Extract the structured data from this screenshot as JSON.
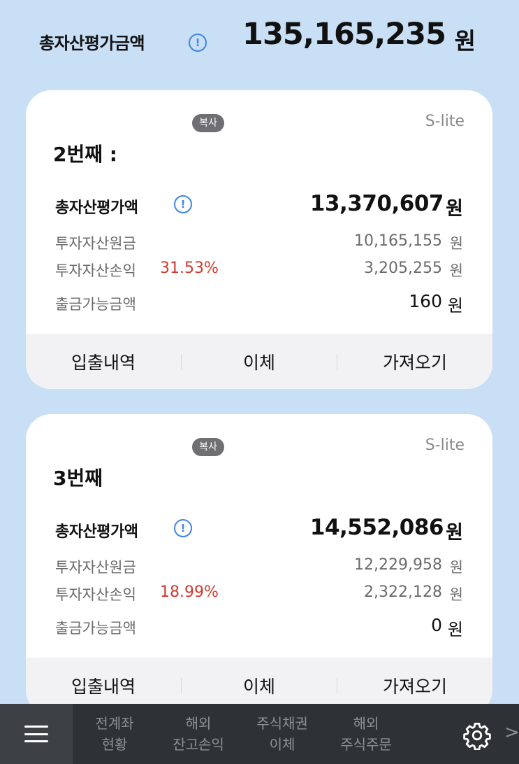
{
  "header": {
    "label": "총자산평가금액",
    "info_glyph": "!",
    "value": "135,165,235",
    "unit": "원"
  },
  "accounts": [
    {
      "copy_label": "복사",
      "product": "S-lite",
      "name": "2번째 :",
      "total_label": "총자산평가액",
      "total_value": "13,370,607",
      "unit": "원",
      "principal_label": "투자자산원금",
      "principal_value": "10,165,155",
      "profit_label": "투자자산손익",
      "profit_pct": "31.53%",
      "profit_value": "3,205,255",
      "withdraw_label": "출금가능금액",
      "withdraw_value": "160",
      "actions": [
        "입출내역",
        "이체",
        "가져오기"
      ]
    },
    {
      "copy_label": "복사",
      "product": "S-lite",
      "name": "3번째",
      "total_label": "총자산평가액",
      "total_value": "14,552,086",
      "unit": "원",
      "principal_label": "투자자산원금",
      "principal_value": "12,229,958",
      "profit_label": "투자자산손익",
      "profit_pct": "18.99%",
      "profit_value": "2,322,128",
      "withdraw_label": "출금가능금액",
      "withdraw_value": "0",
      "actions": [
        "입출내역",
        "이체",
        "가져오기"
      ]
    }
  ],
  "bottom_nav": {
    "menu_icon": "hamburger-icon",
    "items": [
      {
        "line1": "전계좌",
        "line2": "현황"
      },
      {
        "line1": "해외",
        "line2": "잔고손익"
      },
      {
        "line1": "주식채권",
        "line2": "이체"
      },
      {
        "line1": "해외",
        "line2": "주식주문"
      }
    ],
    "settings_icon": "gear-icon",
    "more_glyph": ">"
  },
  "colors": {
    "background": "#c9dff5",
    "accent": "#3f86e6",
    "profit": "#d13a2e",
    "nav_bg": "#2e3236"
  }
}
